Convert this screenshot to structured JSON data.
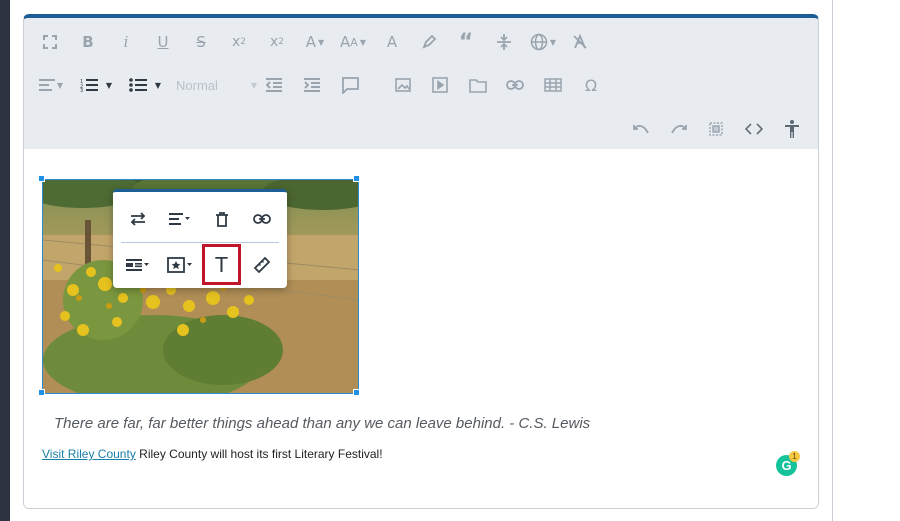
{
  "toolbar": {
    "row1": [
      "fullscreen",
      "bold",
      "italic",
      "underline",
      "strikethrough",
      "subscript",
      "superscript",
      "font-family",
      "font-size",
      "text-color",
      "highlight",
      "blockquote",
      "line-height",
      "language",
      "clear-formatting"
    ],
    "paragraph_format_value": "Normal",
    "row2": [
      "align",
      "ordered-list",
      "unordered-list",
      "paragraph-format",
      "outdent",
      "indent",
      "comment",
      "insert-image",
      "insert-video",
      "insert-file",
      "insert-link",
      "insert-table",
      "special-characters"
    ],
    "row3": [
      "undo",
      "redo",
      "select-all",
      "code-view",
      "accessibility"
    ]
  },
  "content": {
    "quote": "There are far, far better things ahead than any we can leave behind. - C.S. Lewis",
    "link_text": "Visit Riley County",
    "para_text": " Riley County will host its first Literary Festival!"
  },
  "image": {
    "alt": "Field of yellow wildflowers"
  },
  "image_popup": {
    "row1": [
      "replace-image",
      "align-image",
      "remove-image",
      "insert-link"
    ],
    "row2": [
      "display-image",
      "image-style",
      "alternate-text",
      "change-size"
    ],
    "highlighted": "alternate-text"
  },
  "grammarly": {
    "badge_count": "1"
  },
  "colors": {
    "accent": "#1d5e97",
    "selection": "#1e90e6",
    "highlight_box": "#c0142b"
  }
}
